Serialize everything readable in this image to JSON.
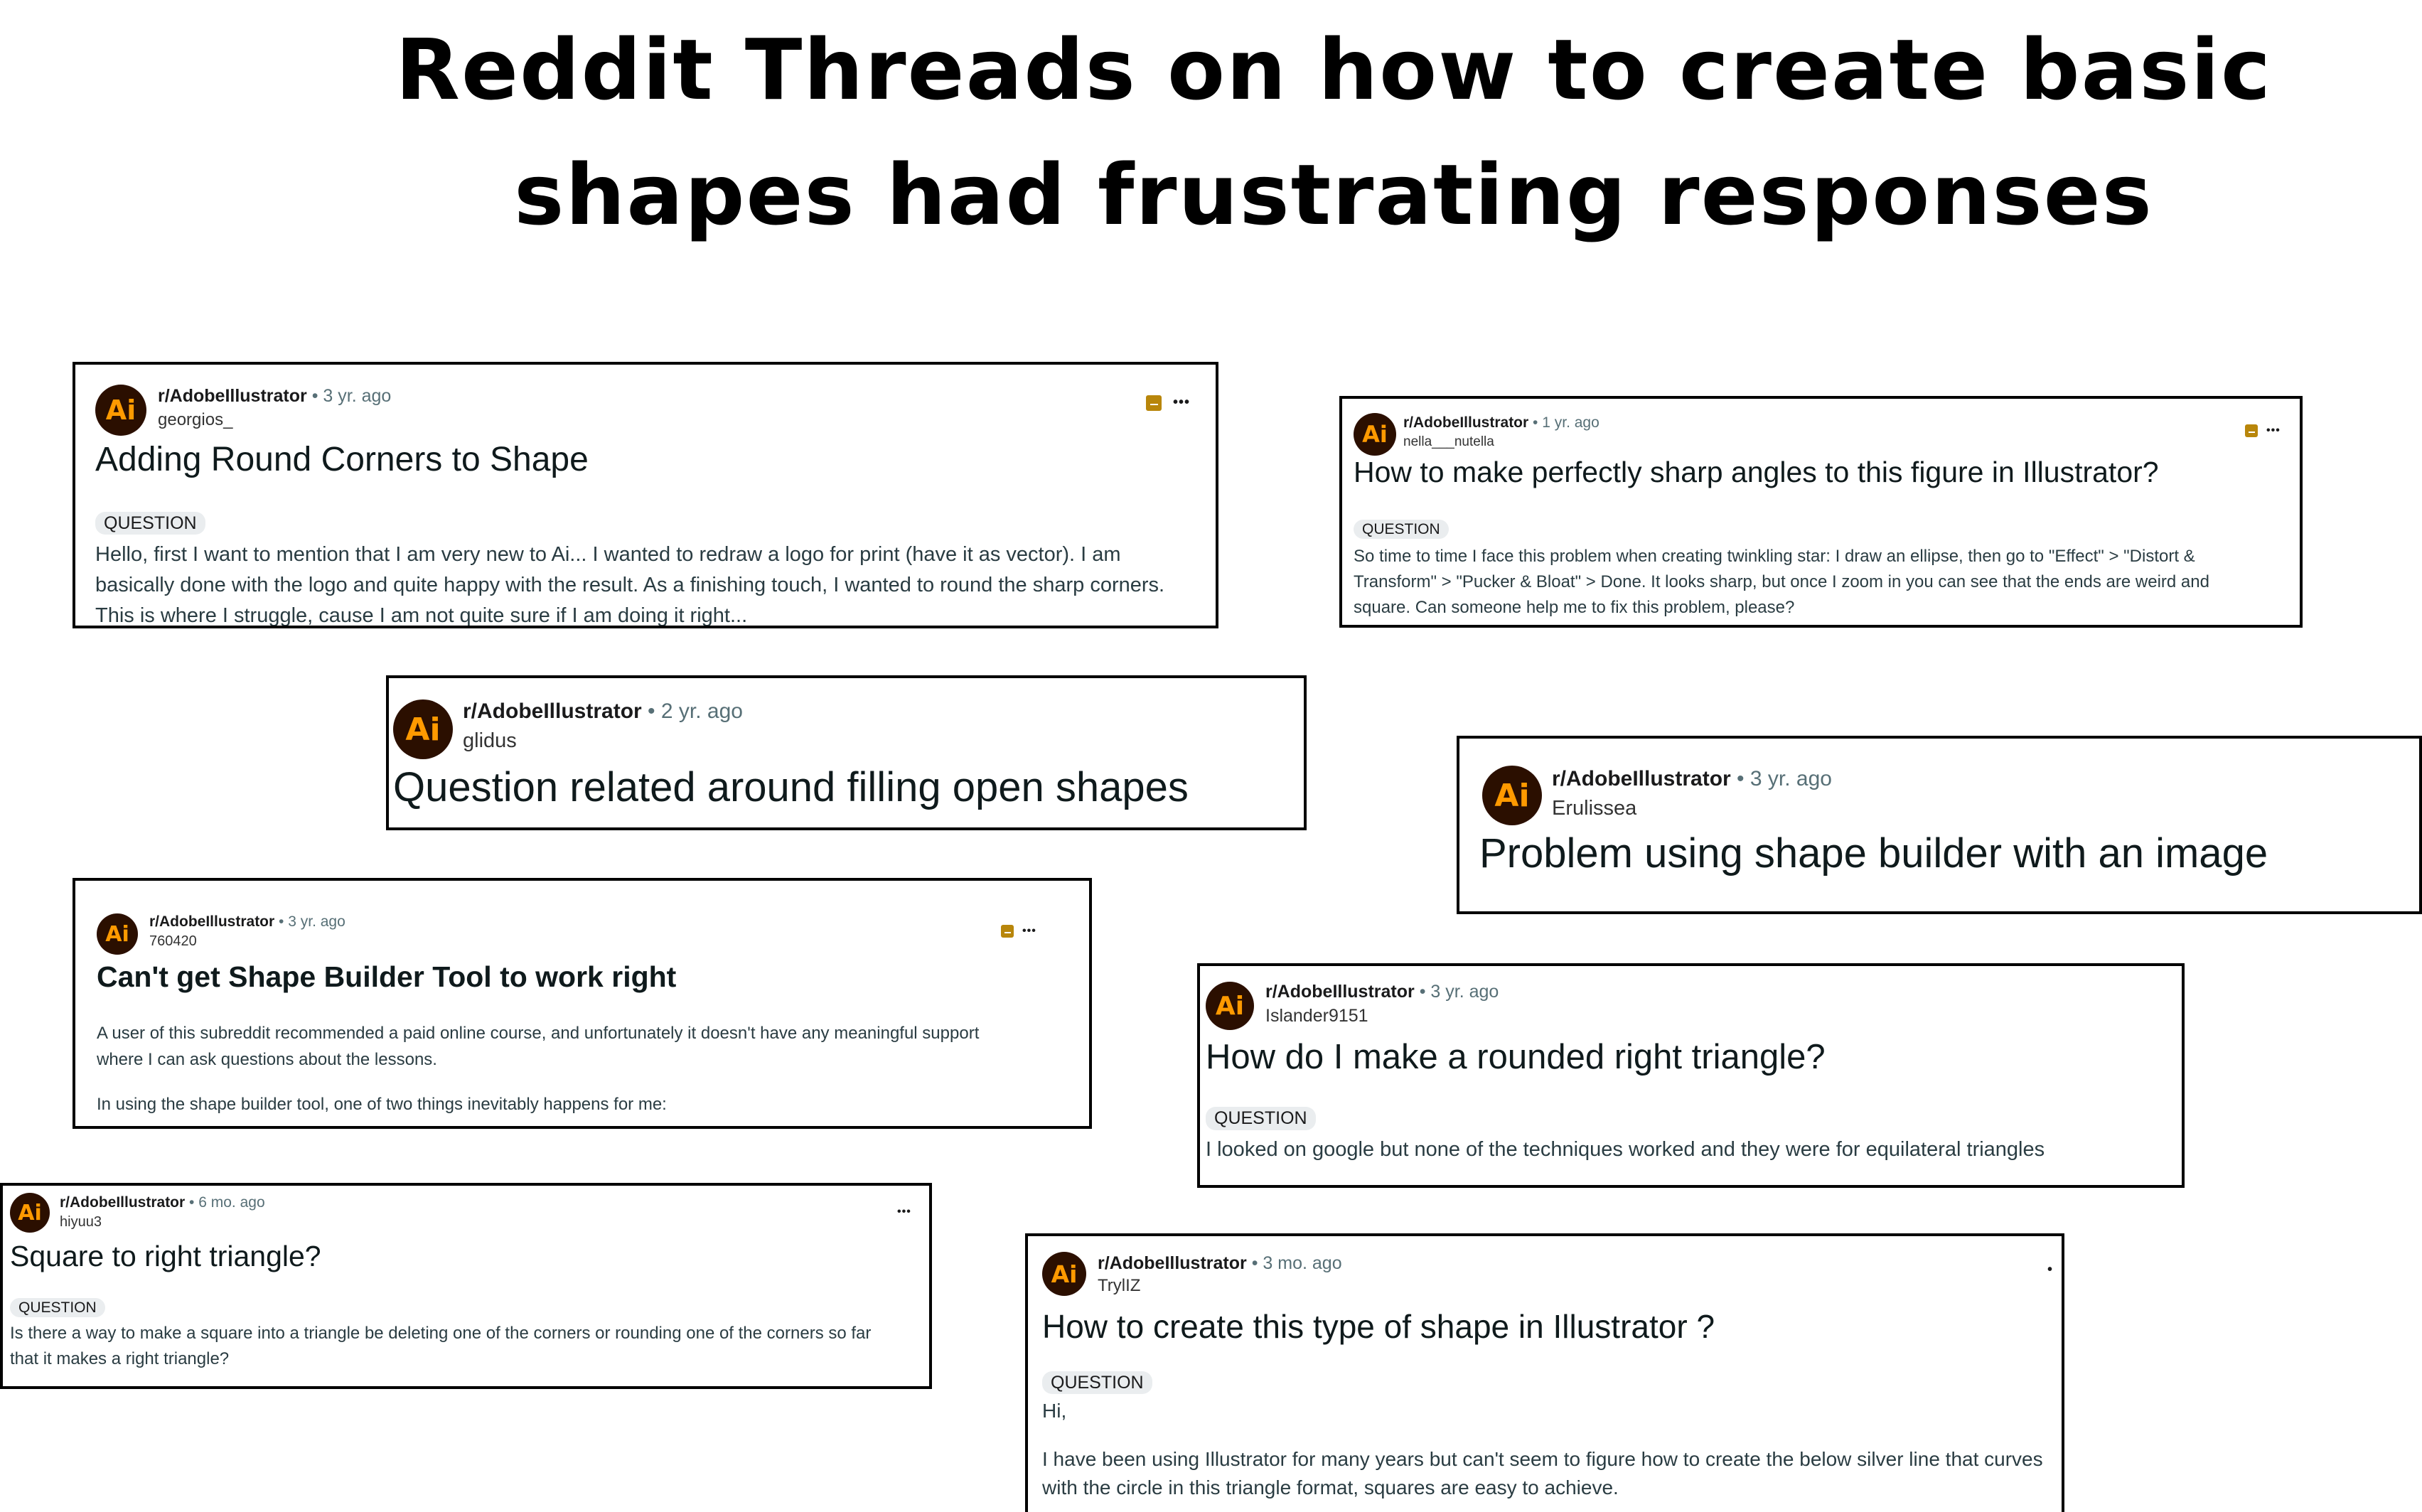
{
  "page": {
    "title_line1": "Reddit Threads on how to create basic",
    "title_line2": "shapes had frustrating responses"
  },
  "icons": {
    "avatar": "adobe-illustrator-logo",
    "archive": "archive-icon",
    "more": "more-options-icon"
  },
  "colors": {
    "avatar_bg": "#2b0f00",
    "avatar_fg": "#ff9a00",
    "archive": "#b8860b",
    "flair_bg": "#eaedef"
  },
  "posts": [
    {
      "avatar": "Ai",
      "subreddit": "r/AdobeIllustrator",
      "sep": "•",
      "time": "3 yr. ago",
      "user": "georgios_",
      "title": "Adding Round Corners to Shape",
      "flair": "QUESTION",
      "more": "•••",
      "body": [
        "Hello, first I want to mention that I am very new to Ai... I wanted to redraw a logo for print (have it as vector). I am",
        "basically done with the logo and quite happy with the result. As a finishing touch, I wanted to round the sharp corners.",
        "This is where I struggle, cause I am not quite sure if I am doing it right..."
      ]
    },
    {
      "avatar": "Ai",
      "subreddit": "r/AdobeIllustrator",
      "sep": "•",
      "time": "1 yr. ago",
      "user": "nella___nutella",
      "title": "How to make perfectly sharp angles to this figure in Illustrator?",
      "flair": "QUESTION",
      "more": "•••",
      "body": [
        "So time to time I face this problem when creating twinkling star: I draw an ellipse, then go to \"Effect\" > \"Distort &",
        "Transform\" > \"Pucker & Bloat\" > Done. It looks sharp, but once I zoom in you can see that the ends are weird and",
        "square. Can someone help me to fix this problem, please?"
      ]
    },
    {
      "avatar": "Ai",
      "subreddit": "r/AdobeIllustrator",
      "sep": "•",
      "time": "2 yr. ago",
      "user": "glidus",
      "title": "Question related around filling open shapes"
    },
    {
      "avatar": "Ai",
      "subreddit": "r/AdobeIllustrator",
      "sep": "•",
      "time": "3 yr. ago",
      "user": "Erulissea",
      "title": "Problem using shape builder with an image"
    },
    {
      "avatar": "Ai",
      "subreddit": "r/AdobeIllustrator",
      "sep": "•",
      "time": "3 yr. ago",
      "user": "760420",
      "title": "Can't get Shape Builder Tool to work right",
      "more": "•••",
      "body": [
        "A user of this subreddit recommended a paid online course, and unfortunately it doesn't have any meaningful support",
        "where I can ask questions about the lessons.",
        "",
        "In using the shape builder tool, one of two things inevitably happens for me:"
      ]
    },
    {
      "avatar": "Ai",
      "subreddit": "r/AdobeIllustrator",
      "sep": "•",
      "time": "3 yr. ago",
      "user": "Islander9151",
      "title": "How do I make a rounded right triangle?",
      "flair": "QUESTION",
      "body": [
        "I looked on google but none of the techniques worked and they were for equilateral triangles"
      ]
    },
    {
      "avatar": "Ai",
      "subreddit": "r/AdobeIllustrator",
      "sep": "•",
      "time": "6 mo. ago",
      "user": "hiyuu3",
      "title": "Square to right triangle?",
      "flair": "QUESTION",
      "more": "•••",
      "body": [
        "Is there a way to make a square into a triangle be deleting one of the corners or rounding one of the corners so far",
        "that it makes a right triangle?"
      ]
    },
    {
      "avatar": "Ai",
      "subreddit": "r/AdobeIllustrator",
      "sep": "•",
      "time": "3 mo. ago",
      "user": "TrylIZ",
      "title": "How to create this type of shape in Illustrator ?",
      "flair": "QUESTION",
      "more": "•",
      "body": [
        "Hi,",
        "",
        "I have been using Illustrator for many years but can't seem to figure how to create the below silver line that curves",
        "with the circle in this triangle format, squares are easy to achieve."
      ]
    }
  ]
}
